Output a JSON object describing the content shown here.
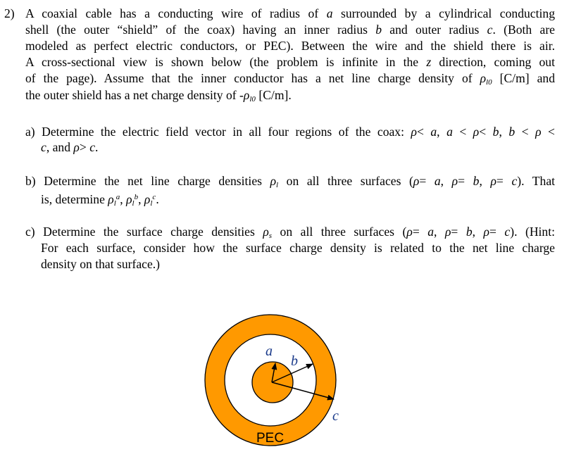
{
  "problem": {
    "number": "2)",
    "intro_lines": [
      [
        "A coaxial cable has a conducting wire of radius of ",
        {
          "i": "a"
        },
        " surrounded by a cylindrical conducting"
      ],
      [
        "shell (the outer “shield” of the coax) having an inner radius ",
        {
          "i": "b"
        },
        " and outer radius ",
        {
          "i": "c"
        },
        ". (Both are"
      ],
      [
        "modeled as perfect electric conductors, or PEC). Between the wire and the shield there is air."
      ],
      [
        "A cross-sectional view is shown below (the problem is infinite in the ",
        {
          "i": "z"
        },
        " direction, coming out"
      ],
      [
        "of the page). Assume that the inner conductor has a net line charge density of ",
        {
          "rho": "l0"
        },
        " [C/m] and"
      ],
      [
        "the outer shield has a net charge density of -",
        {
          "rho": "l0"
        },
        " [C/m]."
      ]
    ]
  },
  "parts": [
    {
      "id": "a",
      "lines": [
        [
          "a) Determine the electric field vector in all four regions of the coax: ",
          {
            "rho": ""
          },
          {
            "t": "< "
          },
          {
            "i": "a"
          },
          {
            "t": ", "
          },
          {
            "i": "a"
          },
          {
            "t": " < "
          },
          {
            "rho": ""
          },
          {
            "t": "< "
          },
          {
            "i": "b"
          },
          {
            "t": ", "
          },
          {
            "i": "b"
          },
          {
            "t": " < "
          },
          {
            "rho": ""
          },
          {
            "t": " <"
          }
        ],
        [
          {
            "i": "c"
          },
          ", and  ",
          {
            "rho": ""
          },
          "> ",
          {
            "i": "c"
          },
          "."
        ]
      ]
    },
    {
      "id": "b",
      "lines": [
        [
          "b) Determine the net line charge densities ",
          {
            "rho": "l"
          },
          " on all three surfaces (",
          {
            "rho": ""
          },
          "= ",
          {
            "i": "a"
          },
          ", ",
          {
            "rho": ""
          },
          "= ",
          {
            "i": "b"
          },
          ", ",
          {
            "rho": ""
          },
          "= ",
          {
            "i": "c"
          },
          "). That"
        ],
        [
          "is, determine ",
          {
            "rho": "l",
            "sup": "a"
          },
          ", ",
          {
            "rho": "l",
            "sup": "b"
          },
          ", ",
          {
            "rho": "l",
            "sup": "c"
          },
          "."
        ]
      ]
    },
    {
      "id": "c",
      "lines": [
        [
          "c) Determine the surface charge densities ",
          {
            "rho": "s"
          },
          " on all three surfaces (",
          {
            "rho": ""
          },
          "= ",
          {
            "i": "a"
          },
          ", ",
          {
            "rho": ""
          },
          "= ",
          {
            "i": "b"
          },
          ", ",
          {
            "rho": ""
          },
          "= ",
          {
            "i": "c"
          },
          "). (Hint:"
        ],
        [
          "For each surface, consider how the surface charge density is related to the net line charge"
        ],
        [
          "density on that surface.)"
        ]
      ]
    }
  ],
  "figure": {
    "labels": {
      "a": "a",
      "b": "b",
      "c": "c",
      "material": "PEC"
    },
    "colors": {
      "conductor": "#ff9900",
      "outline": "#000000",
      "label": "#1a3a8a"
    }
  }
}
